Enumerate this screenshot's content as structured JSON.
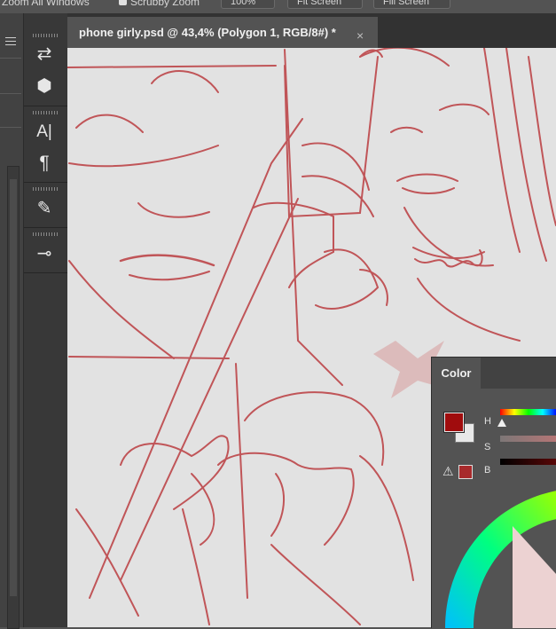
{
  "options_bar": {
    "zoom_all_windows": "Zoom All Windows",
    "scrubby_zoom": "Scrubby Zoom",
    "zoom_percent": "100%",
    "fit_screen": "Fit Screen",
    "fill_screen": "Fill Screen"
  },
  "document": {
    "tab_title": "phone girly.psd @ 43,4% (Polygon 1, RGB/8#) *",
    "close_glyph": "×"
  },
  "toolbar_collapse": "››",
  "dock_icons": [
    {
      "name": "history-icon",
      "glyph": "⇄"
    },
    {
      "name": "3d-icon",
      "glyph": "⬢"
    },
    {
      "name": "character-icon",
      "glyph": "A|"
    },
    {
      "name": "paragraph-icon",
      "glyph": "¶"
    },
    {
      "name": "brush-settings-icon",
      "glyph": "✎"
    },
    {
      "name": "adjust-icon",
      "glyph": "⊸"
    }
  ],
  "color_panel": {
    "tab_label": "Color",
    "h_label": "H",
    "s_label": "S",
    "b_label": "B",
    "foreground_color": "#a00c0d",
    "background_color": "#e8e8e8",
    "warning_glyph": "⚠"
  },
  "colors": {
    "sketch_red": "#b5262a",
    "canvas": "#e2e2e2",
    "panel": "#535353",
    "dark": "#383838"
  }
}
